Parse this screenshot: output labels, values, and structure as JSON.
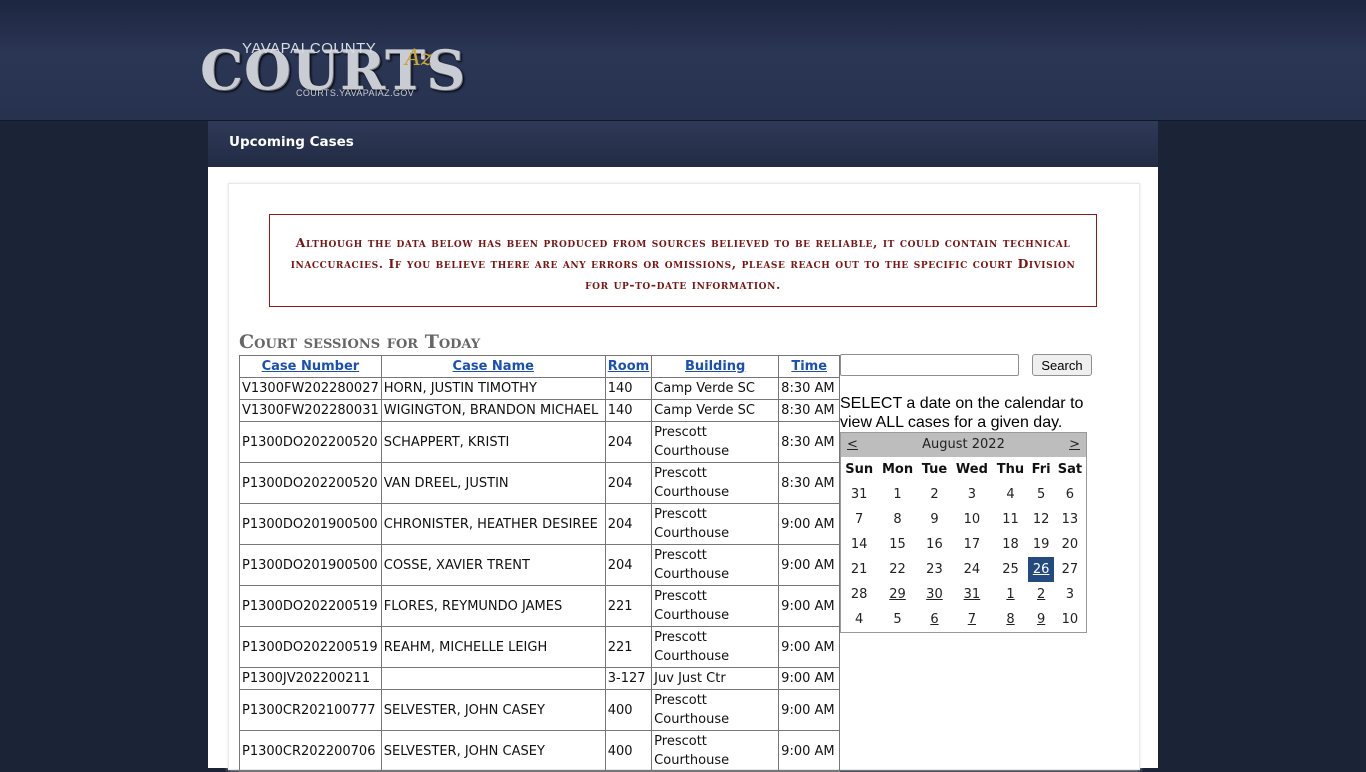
{
  "header": {
    "logo": {
      "county": "YAVAPAI COUNTY",
      "main": "COURTS",
      "state": "Az",
      "url": "COURTS.YAVAPAIAZ.GOV"
    }
  },
  "nav": {
    "title": "Upcoming Cases"
  },
  "notice": "Although the data below has been produced from sources believed to be reliable, it could contain technical inaccuracies. If you believe there are any errors or omissions, please reach out to the specific court Division for up-to-date information.",
  "sessions_title": "Court sessions for Today",
  "table": {
    "headers": [
      "Case Number",
      "Case Name",
      "Room",
      "Building",
      "Time"
    ],
    "rows": [
      [
        "V1300FW202280027",
        "HORN, JUSTIN TIMOTHY",
        "140",
        "Camp Verde SC",
        "8:30 AM"
      ],
      [
        "V1300FW202280031",
        "WIGINGTON, BRANDON MICHAEL",
        "140",
        "Camp Verde SC",
        "8:30 AM"
      ],
      [
        "P1300DO202200520",
        "SCHAPPERT, KRISTI",
        "204",
        "Prescott Courthouse",
        "8:30 AM"
      ],
      [
        "P1300DO202200520",
        "VAN DREEL, JUSTIN",
        "204",
        "Prescott Courthouse",
        "8:30 AM"
      ],
      [
        "P1300DO201900500",
        "CHRONISTER, HEATHER DESIREE",
        "204",
        "Prescott Courthouse",
        "9:00 AM"
      ],
      [
        "P1300DO201900500",
        "COSSE, XAVIER TRENT",
        "204",
        "Prescott Courthouse",
        "9:00 AM"
      ],
      [
        "P1300DO202200519",
        "FLORES, REYMUNDO JAMES",
        "221",
        "Prescott Courthouse",
        "9:00 AM"
      ],
      [
        "P1300DO202200519",
        "REAHM, MICHELLE LEIGH",
        "221",
        "Prescott Courthouse",
        "9:00 AM"
      ],
      [
        "P1300JV202200211",
        "",
        "3-127",
        "Juv Just Ctr",
        "9:00 AM"
      ],
      [
        "P1300CR202100777",
        "SELVESTER, JOHN CASEY",
        "400",
        "Prescott Courthouse",
        "9:00 AM"
      ],
      [
        "P1300CR202200706",
        "SELVESTER, JOHN CASEY",
        "400",
        "Prescott Courthouse",
        "9:00 AM"
      ]
    ]
  },
  "search": {
    "value": "",
    "button_label": "Search"
  },
  "calendar": {
    "instructions": "SELECT a date on the calendar to view ALL cases for a given day.",
    "prev": "<",
    "next": ">",
    "month_label": "August 2022",
    "day_headers": [
      "Sun",
      "Mon",
      "Tue",
      "Wed",
      "Thu",
      "Fri",
      "Sat"
    ],
    "weeks": [
      [
        "31",
        "1",
        "2",
        "3",
        "4",
        "5",
        "6"
      ],
      [
        "7",
        "8",
        "9",
        "10",
        "11",
        "12",
        "13"
      ],
      [
        "14",
        "15",
        "16",
        "17",
        "18",
        "19",
        "20"
      ],
      [
        "21",
        "22",
        "23",
        "24",
        "25",
        "26",
        "27"
      ],
      [
        "28",
        "29",
        "30",
        "31",
        "1",
        "2",
        "3"
      ],
      [
        "4",
        "5",
        "6",
        "7",
        "8",
        "9",
        "10"
      ]
    ],
    "selected": [
      3,
      5
    ],
    "linked": [
      [
        3,
        5
      ],
      [
        4,
        1
      ],
      [
        4,
        2
      ],
      [
        4,
        3
      ],
      [
        4,
        4
      ],
      [
        4,
        5
      ],
      [
        5,
        2
      ],
      [
        5,
        3
      ],
      [
        5,
        4
      ],
      [
        5,
        5
      ]
    ]
  }
}
